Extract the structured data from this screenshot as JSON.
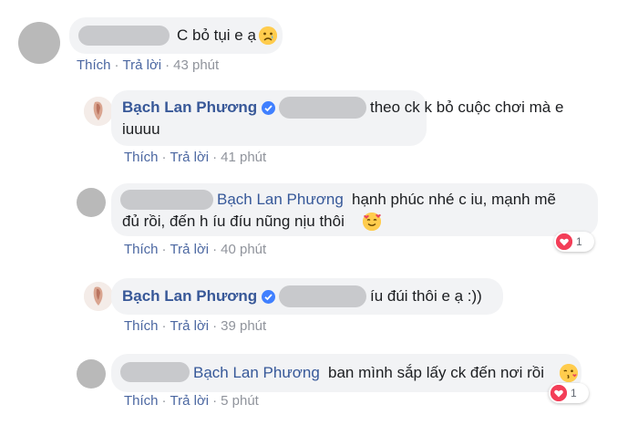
{
  "comments": [
    {
      "text": "C bỏ tụi e ạ",
      "emoji": "sad-face-emoji",
      "actions": {
        "like": "Thích",
        "reply": "Trả lời",
        "time": "43 phút"
      }
    },
    {
      "author": "Bạch Lan Phương",
      "text_line1": "theo ck k bỏ cuộc chơi mà e",
      "text_line2": "iuuuu",
      "actions": {
        "like": "Thích",
        "reply": "Trả lời",
        "time": "41 phút"
      }
    },
    {
      "tag": "Bạch Lan Phương",
      "text_line1": "hạnh phúc nhé c iu, mạnh mẽ",
      "text_line2": "đủ rồi, đến h íu đíu nũng nịu thôi",
      "emoji": "smiling-face-with-hearts-emoji",
      "actions": {
        "like": "Thích",
        "reply": "Trả lời",
        "time": "40 phút"
      },
      "reactions": {
        "icon": "heart-reaction-icon",
        "count": "1"
      }
    },
    {
      "author": "Bạch Lan Phương",
      "text": "íu đúi thôi e ạ :))",
      "actions": {
        "like": "Thích",
        "reply": "Trả lời",
        "time": "39 phút"
      }
    },
    {
      "tag": "Bạch Lan Phương",
      "text": "ban mình sắp lấy ck đến nơi rồi",
      "emoji": "face-blowing-kiss-emoji",
      "actions": {
        "like": "Thích",
        "reply": "Trả lời",
        "time": "5 phút"
      },
      "reactions": {
        "icon": "heart-reaction-icon",
        "count": "1"
      }
    }
  ],
  "colors": {
    "name_link": "#365899",
    "action_link": "#4b67a1",
    "bubble_bg": "#f2f3f5",
    "heart": "#f33e58",
    "verified": "#4080ff"
  }
}
